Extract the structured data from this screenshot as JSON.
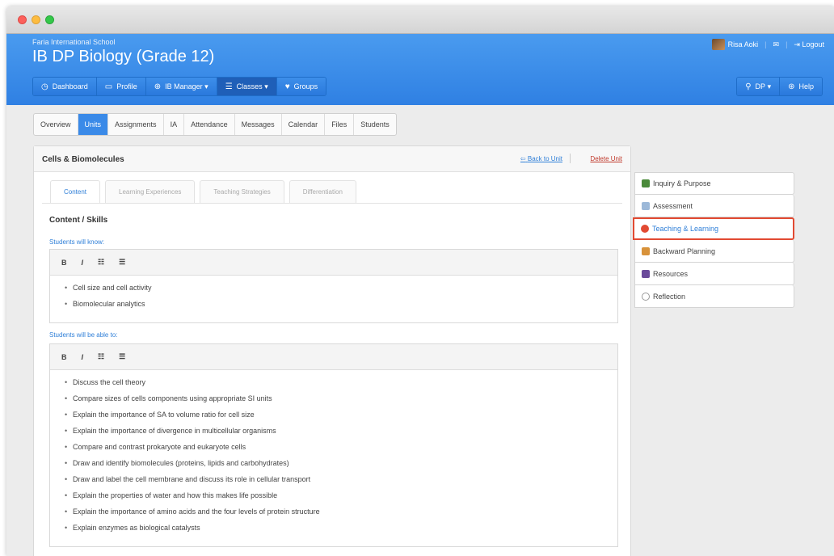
{
  "window": {
    "title": ""
  },
  "header": {
    "school": "Faria International School",
    "course": "IB DP Biology (Grade 12)",
    "user": "Risa Aoki",
    "mail_icon": "mail-icon",
    "logout": "Logout"
  },
  "nav": {
    "items": [
      {
        "label": "Dashboard",
        "icon": "clock-icon"
      },
      {
        "label": "Profile",
        "icon": "card-icon"
      },
      {
        "label": "IB Manager",
        "icon": "globe-icon"
      },
      {
        "label": "Classes",
        "icon": "classes-icon"
      },
      {
        "label": "Groups",
        "icon": "groups-icon"
      }
    ],
    "right": [
      {
        "label": "DP",
        "icon": "search-icon"
      },
      {
        "label": "Help",
        "icon": "lifebuoy-icon"
      }
    ]
  },
  "tabs": [
    "Overview",
    "Units",
    "Assignments",
    "IA",
    "Attendance",
    "Messages",
    "Calendar",
    "Files",
    "Students"
  ],
  "panel": {
    "title": "Cells & Biomolecules",
    "back": "Back to Unit",
    "delete": "Delete Unit",
    "subtabs": [
      "Content",
      "Learning Experiences",
      "Teaching Strategies",
      "Differentiation"
    ],
    "section_title": "Content / Skills",
    "know_label": "Students will know:",
    "know_items": [
      "Cell size and cell activity",
      "Biomolecular analytics"
    ],
    "able_label": "Students will be able to:",
    "able_items": [
      "Discuss the cell theory",
      "Compare sizes of cells components using appropriate SI units",
      "Explain the importance of SA to volume ratio for cell size",
      "Explain the importance of divergence in multicellular organisms",
      "Compare and contrast prokaryote and eukaryote cells",
      "Draw and identify biomolecules (proteins, lipids and carbohydrates)",
      "Draw and label the cell membrane and discuss its role in cellular transport",
      "Explain the properties of water and how this makes life possible",
      "Explain the importance of amino acids and the four levels of protein structure",
      "Explain enzymes as biological catalysts"
    ],
    "toolbar": {
      "bold": "B",
      "italic": "I"
    }
  },
  "side": [
    {
      "label": "Inquiry & Purpose",
      "color": "#4a8a3a"
    },
    {
      "label": "Assessment",
      "color": "#9cb8d8"
    },
    {
      "label": "Teaching & Learning",
      "color": "#e24a32"
    },
    {
      "label": "Backward Planning",
      "color": "#d8923a"
    },
    {
      "label": "Resources",
      "color": "#6a4a9a"
    },
    {
      "label": "Reflection",
      "color": "#bbbbbb"
    }
  ],
  "colors": {
    "accent": "#2f80e3",
    "active_outline": "#e24a32"
  }
}
